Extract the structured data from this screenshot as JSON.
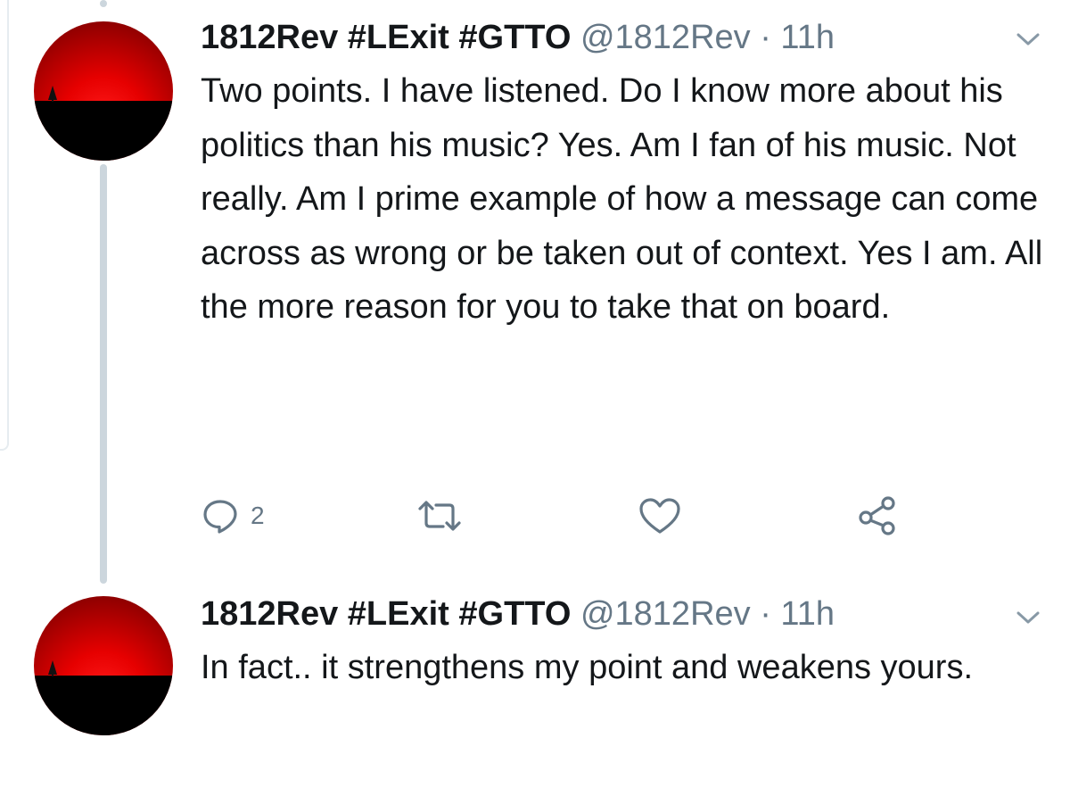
{
  "tweets": [
    {
      "display_name": "1812Rev #LExit #GTTO",
      "handle": "@1812Rev",
      "separator": "·",
      "time": "11h",
      "text": "Two points. I have listened. Do I know more about his politics than his music? Yes. Am I fan of his music. Not really. Am I prime example of how a message can come across as wrong or be taken out of context. Yes I am. All the more reason for you to take that on board.",
      "reply_count": "2",
      "icons": {
        "reply": "reply-icon",
        "retweet": "retweet-icon",
        "like": "heart-icon",
        "share": "share-icon",
        "menu": "chevron-down-icon"
      }
    },
    {
      "display_name": "1812Rev #LExit #GTTO",
      "handle": "@1812Rev",
      "separator": "·",
      "time": "11h",
      "text": "In fact.. it strengthens my point and weakens yours."
    }
  ],
  "colors": {
    "text": "#14171a",
    "secondary": "#657786",
    "thread_line": "#ccd6dd",
    "avatar_red": "#e60000",
    "avatar_black": "#000000"
  }
}
